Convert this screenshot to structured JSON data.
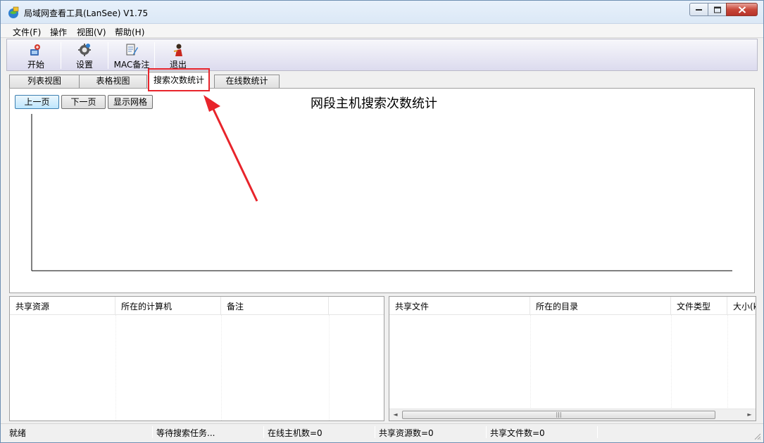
{
  "window": {
    "title": "局域网查看工具(LanSee) V1.75",
    "controls": {
      "minimize": "minimize",
      "maximize": "maximize",
      "close": "close"
    }
  },
  "menu": [
    {
      "label": "文件(F)"
    },
    {
      "label": "操作"
    },
    {
      "label": "视图(V)"
    },
    {
      "label": "帮助(H)"
    }
  ],
  "toolbar": [
    {
      "label": "开始",
      "icon": "start-icon"
    },
    {
      "label": "设置",
      "icon": "settings-icon"
    },
    {
      "label": "MAC备注",
      "icon": "mac-note-icon"
    },
    {
      "label": "退出",
      "icon": "exit-icon"
    }
  ],
  "tabs": [
    {
      "label": "列表视图",
      "active": false
    },
    {
      "label": "表格视图",
      "active": false
    },
    {
      "label": "搜索次数统计",
      "active": true
    },
    {
      "label": "在线数统计",
      "active": false
    }
  ],
  "chart_pane": {
    "buttons": {
      "prev": "上一页",
      "next": "下一页",
      "grid": "显示网格"
    },
    "title": "网段主机搜索次数统计"
  },
  "chart_data": {
    "type": "bar",
    "title": "网段主机搜索次数统计",
    "categories": [],
    "values": [],
    "xlabel": "",
    "ylabel": "",
    "grid": false
  },
  "shares_list": {
    "columns": [
      "共享资源",
      "所在的计算机",
      "备注"
    ]
  },
  "files_list": {
    "columns": [
      "共享文件",
      "所在的目录",
      "文件类型",
      "大小(k"
    ]
  },
  "statusbar": {
    "state": "就绪",
    "task": "等待搜索任务...",
    "online_hosts": "在线主机数=0",
    "shared_resources": "共享资源数=0",
    "shared_files": "共享文件数=0"
  },
  "colors": {
    "highlight_box": "#e8242b",
    "annotation_arrow": "#e8242b",
    "toolbar_bg": "#dcdbee"
  }
}
